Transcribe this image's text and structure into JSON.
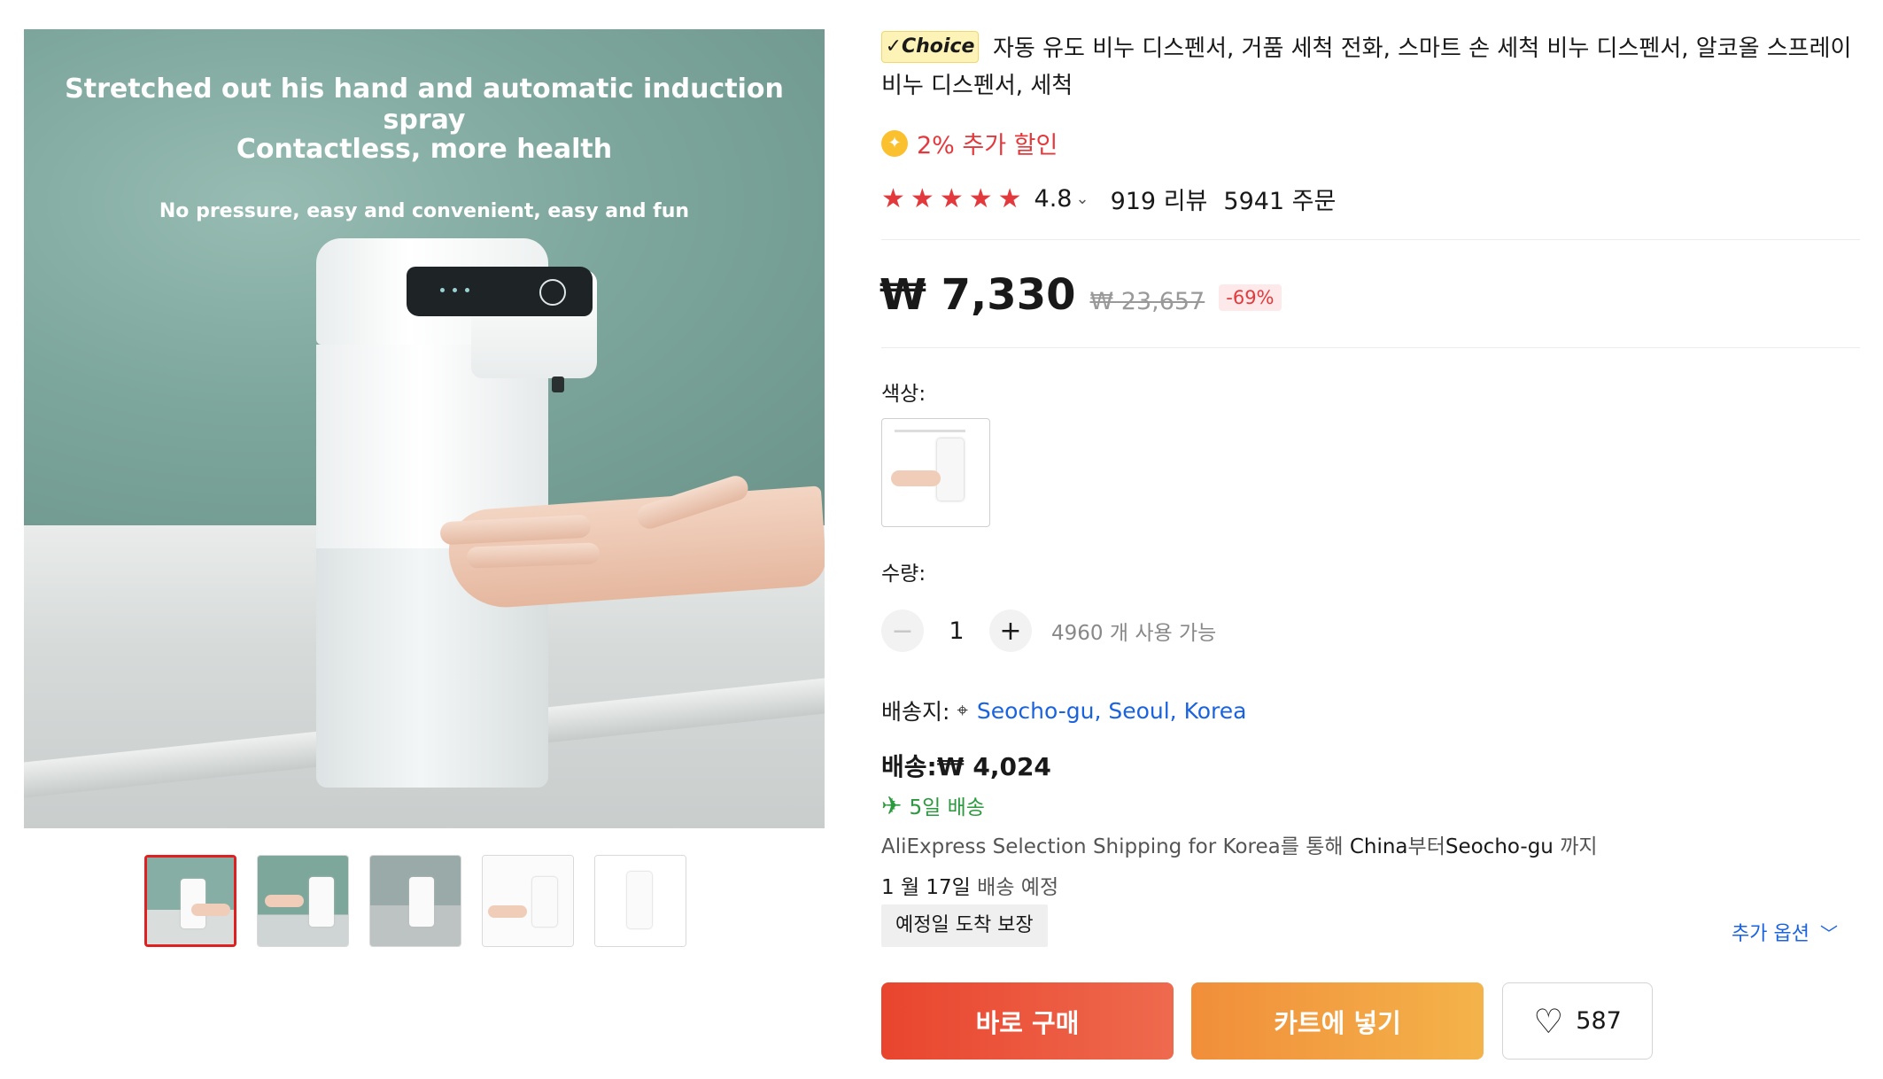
{
  "gallery": {
    "promo_line_1": "Stretched out his hand and automatic induction spray",
    "promo_line_2": "Contactless, more health",
    "promo_line_3": "No pressure, easy and convenient, easy and fun",
    "thumbnails": [
      "thumb-1",
      "thumb-2",
      "thumb-3",
      "thumb-4",
      "thumb-5"
    ],
    "active_thumbnail_index": 0
  },
  "product": {
    "badge": "✓Choice",
    "title": "자동 유도 비누 디스펜서, 거품 세척 전화, 스마트 손 세척 비누 디스펜서, 알코올 스프레이 비누 디스펜서, 세척",
    "extra_discount": "2% 추가 할인",
    "rating": "4.8",
    "reviews": "919 리뷰",
    "orders": "5941 주문"
  },
  "price": {
    "current": "₩ 7,330",
    "original": "₩ 23,657",
    "discount": "-69%"
  },
  "options": {
    "color_label": "색상:",
    "quantity_label": "수량:",
    "quantity_value": "1",
    "available": "4960 개 사용 가능"
  },
  "shipping": {
    "ship_to_label": "배송지:",
    "location": "Seocho-gu, Seoul, Korea",
    "cost": "배송:₩ 4,024",
    "delivery_days": "5일 배송",
    "selection_prefix": "AliExpress Selection Shipping for Korea를 통해 ",
    "selection_from": "China",
    "selection_mid": "부터",
    "selection_to": "Seocho-gu",
    "selection_suffix": " 까지",
    "eta_date": "1 월 17일",
    "eta_suffix": " 배송 예정",
    "guarantee": "예정일 도착 보장",
    "more_options": "추가 옵션"
  },
  "actions": {
    "buy_now": "바로 구매",
    "add_to_cart": "카트에 넣기",
    "wishlist_count": "587"
  },
  "colors": {
    "accent_red": "#e4393c",
    "link_blue": "#1a63e0",
    "delivery_green": "#2b9a3e"
  }
}
